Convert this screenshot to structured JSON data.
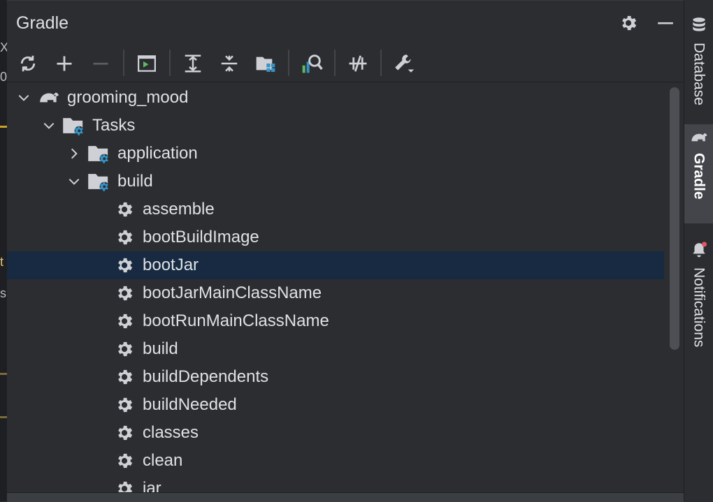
{
  "panel": {
    "title": "Gradle"
  },
  "header_buttons": [
    {
      "name": "settings-gear-icon"
    },
    {
      "name": "minimize-icon"
    }
  ],
  "toolbar": [
    "reload-icon",
    "add-icon",
    "remove-icon",
    "run-task-icon",
    "expand-all-icon",
    "collapse-all-icon",
    "group-modules-icon",
    "analyze-dependencies-icon",
    "toggle-offline-icon",
    "build-tool-settings-icon"
  ],
  "tree": [
    {
      "label": "grooming_mood",
      "depth": 0,
      "expanded": true,
      "kind": "project"
    },
    {
      "label": "Tasks",
      "depth": 1,
      "expanded": true,
      "kind": "folder"
    },
    {
      "label": "application",
      "depth": 2,
      "expanded": false,
      "kind": "folder"
    },
    {
      "label": "build",
      "depth": 2,
      "expanded": true,
      "kind": "folder"
    },
    {
      "label": "assemble",
      "depth": 3,
      "kind": "task"
    },
    {
      "label": "bootBuildImage",
      "depth": 3,
      "kind": "task"
    },
    {
      "label": "bootJar",
      "depth": 3,
      "kind": "task",
      "selected": true
    },
    {
      "label": "bootJarMainClassName",
      "depth": 3,
      "kind": "task"
    },
    {
      "label": "bootRunMainClassName",
      "depth": 3,
      "kind": "task"
    },
    {
      "label": "build",
      "depth": 3,
      "kind": "task"
    },
    {
      "label": "buildDependents",
      "depth": 3,
      "kind": "task"
    },
    {
      "label": "buildNeeded",
      "depth": 3,
      "kind": "task"
    },
    {
      "label": "classes",
      "depth": 3,
      "kind": "task"
    },
    {
      "label": "clean",
      "depth": 3,
      "kind": "task"
    },
    {
      "label": "jar",
      "depth": 3,
      "kind": "task"
    }
  ],
  "right_toolbar": [
    {
      "label": "Database",
      "icon": "database-icon",
      "active": false
    },
    {
      "label": "Gradle",
      "icon": "gradle-elephant-icon",
      "active": true
    },
    {
      "label": "Notifications",
      "icon": "bell-icon",
      "active": false,
      "badge": true
    }
  ],
  "colors": {
    "background": "#2b2d30",
    "selection": "#172a41",
    "text": "#dfe1e5",
    "icon_gray": "#ced0d6",
    "icon_blue": "#3592c4",
    "icon_green": "#5fb865",
    "badge_red": "#e55765"
  }
}
